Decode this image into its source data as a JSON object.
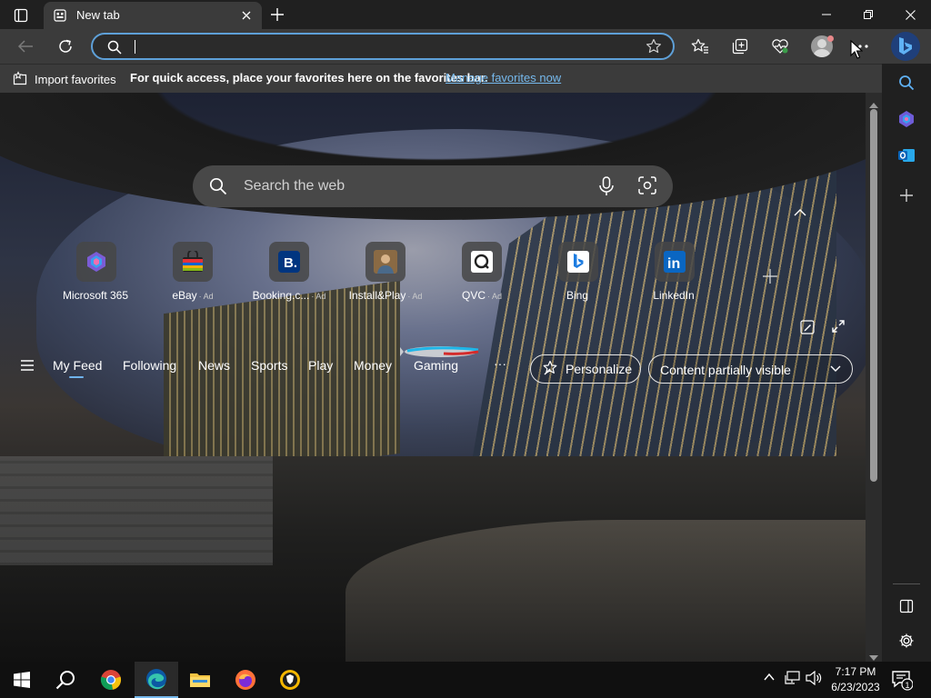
{
  "window": {
    "tab_title": "New tab",
    "new_tab_symbol": "+"
  },
  "toolbar": {
    "address_value": "",
    "address_placeholder": ""
  },
  "favorites_bar": {
    "import_label": "Import favorites",
    "message": "For quick access, place your favorites here on the favorites bar.",
    "link": "Manage favorites now"
  },
  "newtab": {
    "search_placeholder": "Search the web",
    "quick_links": [
      {
        "label": "Microsoft 365",
        "ad": ""
      },
      {
        "label": "eBay",
        "ad": "· Ad"
      },
      {
        "label": "Booking.c...",
        "ad": "· Ad"
      },
      {
        "label": "Install&Play",
        "ad": "· Ad"
      },
      {
        "label": "QVC",
        "ad": "· Ad"
      },
      {
        "label": "Bing",
        "ad": ""
      },
      {
        "label": "LinkedIn",
        "ad": ""
      }
    ],
    "feed_nav": [
      "My Feed",
      "Following",
      "News",
      "Sports",
      "Play",
      "Money",
      "Gaming"
    ],
    "more": "···",
    "personalize": "Personalize",
    "content_visibility": "Content partially visible"
  },
  "taskbar": {
    "time": "7:17 PM",
    "date": "6/23/2023",
    "notification_count": "1"
  },
  "colors": {
    "accent": "#76b9ed",
    "address_border": "#5ea0d8",
    "toolbar_bg": "#3b3b3b",
    "titlebar_bg": "#202020"
  },
  "icons": [
    "tab-actions-icon",
    "new-tab-icon",
    "minimize-icon",
    "restore-icon",
    "close-icon",
    "back-icon",
    "refresh-icon",
    "search-icon",
    "star-icon",
    "favorites-icon",
    "collections-icon",
    "performance-icon",
    "profile-icon",
    "more-icon",
    "bing-chat-icon",
    "microphone-icon",
    "visual-search-icon",
    "hamburger-icon",
    "settings-icon",
    "windows-icon",
    "chrome-icon",
    "edge-icon",
    "file-explorer-icon",
    "firefox-icon",
    "brave-icon"
  ]
}
